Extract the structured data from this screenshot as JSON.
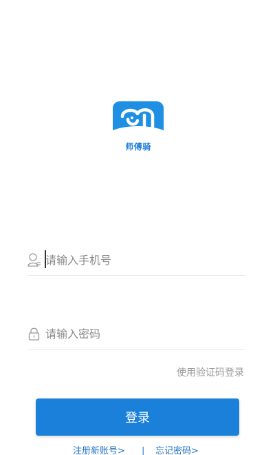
{
  "logo": {
    "brand_text": "师傅骑",
    "icon": "elephant-logo-icon",
    "accent": "#1e8fe3"
  },
  "form": {
    "phone": {
      "placeholder": "请输入手机号",
      "value": "",
      "icon": "user-icon"
    },
    "password": {
      "placeholder": "请输入密码",
      "value": "",
      "icon": "lock-icon"
    },
    "sms_login_label": "使用验证码登录",
    "login_label": "登录"
  },
  "links": {
    "register_label": "注册新账号>",
    "divider": "|",
    "forgot_label": "忘记密码>"
  },
  "colors": {
    "primary": "#1a80d9",
    "link": "#1f6fc4",
    "muted": "#9a9a9a"
  }
}
